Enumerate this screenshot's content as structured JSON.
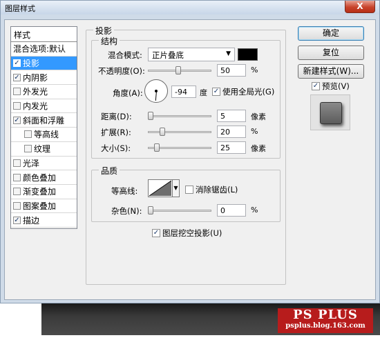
{
  "window": {
    "title": "图层样式",
    "close_glyph": "X"
  },
  "style_list": {
    "header": "样式",
    "items": [
      {
        "label": "混合选项:默认",
        "checkbox": false,
        "checked": false,
        "selected": false,
        "indent": false
      },
      {
        "label": "投影",
        "checkbox": true,
        "checked": true,
        "selected": true,
        "indent": false
      },
      {
        "label": "内阴影",
        "checkbox": true,
        "checked": true,
        "selected": false,
        "indent": false
      },
      {
        "label": "外发光",
        "checkbox": true,
        "checked": false,
        "selected": false,
        "indent": false
      },
      {
        "label": "内发光",
        "checkbox": true,
        "checked": false,
        "selected": false,
        "indent": false
      },
      {
        "label": "斜面和浮雕",
        "checkbox": true,
        "checked": true,
        "selected": false,
        "indent": false
      },
      {
        "label": "等高线",
        "checkbox": true,
        "checked": false,
        "selected": false,
        "indent": true
      },
      {
        "label": "纹理",
        "checkbox": true,
        "checked": false,
        "selected": false,
        "indent": true
      },
      {
        "label": "光泽",
        "checkbox": true,
        "checked": false,
        "selected": false,
        "indent": false
      },
      {
        "label": "颜色叠加",
        "checkbox": true,
        "checked": false,
        "selected": false,
        "indent": false
      },
      {
        "label": "渐变叠加",
        "checkbox": true,
        "checked": false,
        "selected": false,
        "indent": false
      },
      {
        "label": "图案叠加",
        "checkbox": true,
        "checked": false,
        "selected": false,
        "indent": false
      },
      {
        "label": "描边",
        "checkbox": true,
        "checked": true,
        "selected": false,
        "indent": false
      }
    ]
  },
  "drop_shadow": {
    "title": "投影",
    "structure": {
      "title": "结构",
      "blend_mode_label": "混合模式:",
      "blend_mode_value": "正片叠底",
      "shadow_color": "#000000",
      "opacity_label": "不透明度(O):",
      "opacity_value": "50",
      "opacity_fraction": 0.5,
      "opacity_unit": "%",
      "angle_label": "角度(A):",
      "angle_value": "-94",
      "angle_unit": "度",
      "global_light_label": "使用全局光(G)",
      "global_light_checked": true,
      "distance_label": "距离(D):",
      "distance_value": "5",
      "distance_unit": "像素",
      "spread_label": "扩展(R):",
      "spread_value": "20",
      "spread_unit": "%",
      "size_label": "大小(S):",
      "size_value": "25",
      "size_unit": "像素"
    },
    "quality": {
      "title": "品质",
      "contour_label": "等高线:",
      "anti_alias_label": "消除锯齿(L)",
      "anti_alias_checked": false,
      "noise_label": "杂色(N):",
      "noise_value": "0",
      "noise_unit": "%"
    },
    "knockout_label": "图层挖空投影(U)",
    "knockout_checked": true
  },
  "buttons": {
    "ok": "确定",
    "reset": "复位",
    "new_style": "新建样式(W)...",
    "preview": "预览(V)",
    "preview_checked": true
  },
  "check_glyph": "✓",
  "dropdown_glyph": "▼",
  "watermark": {
    "big": "PS PLUS",
    "small": "psplus.blog.163.com"
  }
}
